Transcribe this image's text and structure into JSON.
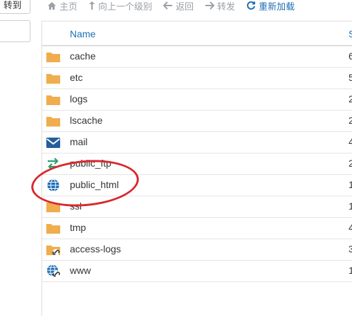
{
  "left": {
    "goto_label": "转到"
  },
  "toolbar": {
    "home": "主页",
    "up": "向上一个级别",
    "back": "返回",
    "forward": "转发",
    "reload": "重新加载"
  },
  "table": {
    "columns": {
      "name": "Name",
      "size": "S"
    },
    "rows": [
      {
        "name": "cache",
        "size": "6",
        "icon": "folder-icon"
      },
      {
        "name": "etc",
        "size": "5",
        "icon": "folder-icon"
      },
      {
        "name": "logs",
        "size": "2",
        "icon": "folder-icon"
      },
      {
        "name": "lscache",
        "size": "2",
        "icon": "folder-icon"
      },
      {
        "name": "mail",
        "size": "4",
        "icon": "mail-icon"
      },
      {
        "name": "public_ftp",
        "size": "2",
        "icon": "ftp-transfer-icon"
      },
      {
        "name": "public_html",
        "size": "1",
        "icon": "globe-icon"
      },
      {
        "name": "ssl",
        "size": "1",
        "icon": "folder-icon"
      },
      {
        "name": "tmp",
        "size": "4",
        "icon": "folder-icon"
      },
      {
        "name": "access-logs",
        "size": "3",
        "icon": "folder-link-icon"
      },
      {
        "name": "www",
        "size": "1",
        "icon": "globe-link-icon"
      }
    ]
  },
  "colors": {
    "accent": "#1f6fb5",
    "folder": "#f0ad4e",
    "annotation": "#d9272d",
    "ftp": "#2b9c6d"
  }
}
